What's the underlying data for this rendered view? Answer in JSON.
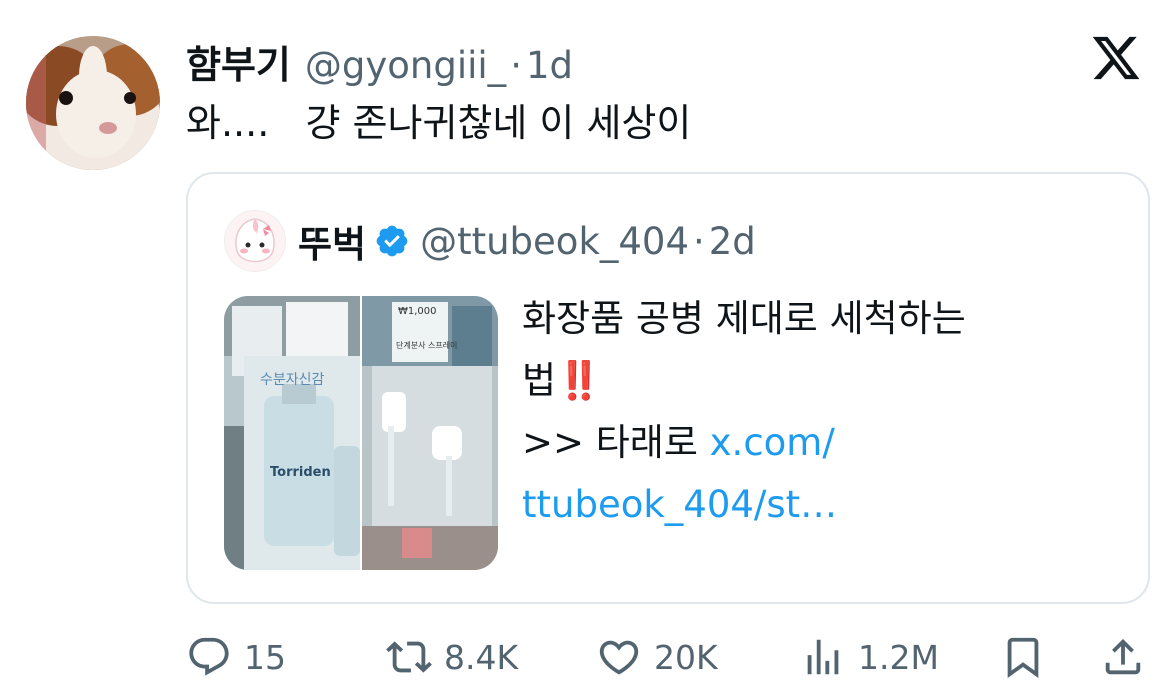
{
  "tweet": {
    "author_name": "햠부기",
    "author_handle": "@gyongiii_",
    "separator": "·",
    "time": "1d",
    "text": "와....   걍 존나귀찮네 이 세상이"
  },
  "quoted": {
    "author_name": "뚜벅",
    "author_handle": "@ttubeok_404",
    "separator": "·",
    "time": "2d",
    "text_line1": "화장품 공병 제대로 세척하는",
    "text_line2": "법",
    "text_line2_emoji": "‼️",
    "text_line3_prefix": ">> 타래로 ",
    "link_part1": "x.com/",
    "link_part2": "ttubeok_404/st…",
    "media_left_text": "수분자신감",
    "media_left_brand": "Torriden",
    "media_right_label1": "₩1,000",
    "media_right_label2": "단계분사 스프레이"
  },
  "actions": {
    "reply_count": "15",
    "retweet_count": "8.4K",
    "like_count": "20K",
    "view_count": "1.2M"
  },
  "icons": {
    "platform": "x-logo-icon",
    "verified": "verified-badge-icon",
    "reply": "reply-icon",
    "retweet": "retweet-icon",
    "like": "heart-icon",
    "views": "views-icon",
    "bookmark": "bookmark-icon",
    "share": "share-icon"
  },
  "colors": {
    "link": "#1d9bf0",
    "secondary_text": "#536471",
    "verified": "#1d9bf0",
    "border": "#e1e6ea"
  }
}
